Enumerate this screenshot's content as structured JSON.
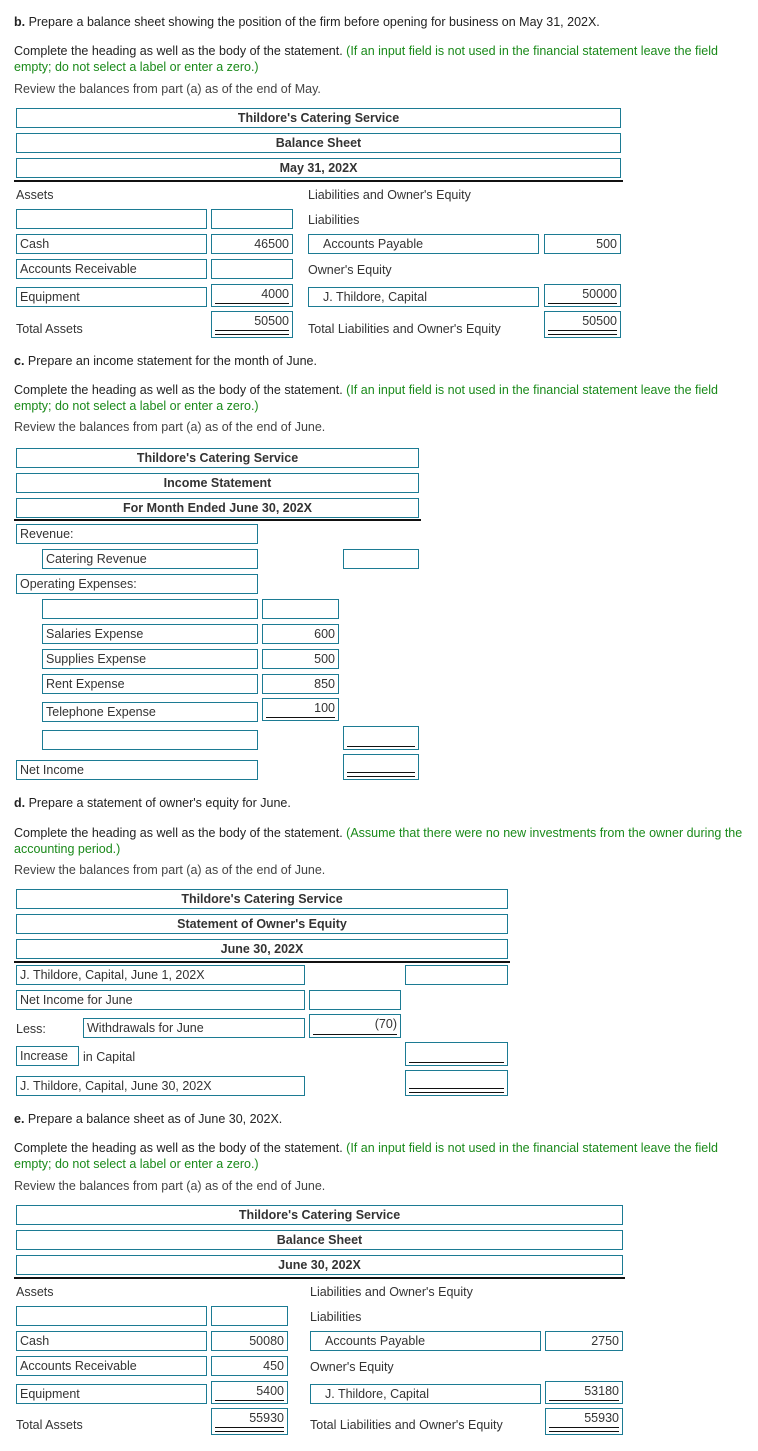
{
  "instructions": {
    "complete_heading": "Complete the heading as well as the body of the statement.",
    "note_blank": "(If an input field is not used in the financial statement leave the field empty; do not select a label or enter a zero.)",
    "note_no_investment": "(Assume that there were no new investments from the owner during the accounting period.)"
  },
  "part_b": {
    "letter": "b.",
    "prompt": "Prepare a balance sheet showing the position of the firm before opening for business on May 31, 202X.",
    "review": "Review the balances from part (a) as of the end of May.",
    "heading": {
      "company": "Thildore's Catering Service",
      "title": "Balance Sheet",
      "date": "May 31, 202X"
    },
    "assets_label": "Assets",
    "liab_equity_label": "Liabilities and Owner's Equity",
    "liabilities_label": "Liabilities",
    "owners_equity_label": "Owner's Equity",
    "total_assets_label": "Total Assets",
    "total_liab_equity_label": "Total Liabilities and Owner's Equity",
    "asset_rows": [
      {
        "label": "",
        "value": ""
      },
      {
        "label": "Cash",
        "value": "46500"
      },
      {
        "label": "Accounts Receivable",
        "value": ""
      },
      {
        "label": "Equipment",
        "value": "4000"
      }
    ],
    "total_assets": "50500",
    "liability_row": {
      "label": "Accounts Payable",
      "value": "500"
    },
    "equity_row": {
      "label": "J. Thildore, Capital",
      "value": "50000"
    },
    "total_liab_equity": "50500"
  },
  "part_c": {
    "letter": "c.",
    "prompt": "Prepare an income statement for the month of June.",
    "review": "Review the balances from part (a) as of the end of June.",
    "heading": {
      "company": "Thildore's Catering Service",
      "title": "Income Statement",
      "date": "For Month Ended June 30, 202X"
    },
    "revenue_label": "Revenue:",
    "revenue_row": {
      "label": "Catering Revenue",
      "value": ""
    },
    "opex_label": "Operating Expenses:",
    "expense_rows": [
      {
        "label": "",
        "value": ""
      },
      {
        "label": "Salaries Expense",
        "value": "600"
      },
      {
        "label": "Supplies Expense",
        "value": "500"
      },
      {
        "label": "Rent Expense",
        "value": "850"
      },
      {
        "label": "Telephone Expense",
        "value": "100"
      }
    ],
    "total_expense_row": {
      "label": "",
      "value": ""
    },
    "net_income_row": {
      "label": "Net Income",
      "value": ""
    }
  },
  "part_d": {
    "letter": "d.",
    "prompt": "Prepare a statement of owner's equity for June.",
    "review": "Review the balances from part (a) as of the end of June.",
    "heading": {
      "company": "Thildore's Catering Service",
      "title": "Statement of Owner's Equity",
      "date": "June 30, 202X"
    },
    "capital_begin": {
      "label": "J. Thildore, Capital, June 1, 202X",
      "value": ""
    },
    "net_income": {
      "label": "Net Income for June",
      "value": ""
    },
    "less_label": "Less:",
    "withdrawals": {
      "label": "Withdrawals for June",
      "value": "(70)"
    },
    "change_select": "Increase",
    "change_suffix": "in Capital",
    "change_value": "",
    "capital_end": {
      "label": "J. Thildore, Capital, June 30, 202X",
      "value": ""
    }
  },
  "part_e": {
    "letter": "e.",
    "prompt": "Prepare a balance sheet as of June 30, 202X.",
    "review": "Review the balances from part (a) as of the end of June.",
    "heading": {
      "company": "Thildore's Catering Service",
      "title": "Balance Sheet",
      "date": "June 30, 202X"
    },
    "assets_label": "Assets",
    "liab_equity_label": "Liabilities and Owner's Equity",
    "liabilities_label": "Liabilities",
    "owners_equity_label": "Owner's Equity",
    "total_assets_label": "Total Assets",
    "total_liab_equity_label": "Total Liabilities and Owner's Equity",
    "asset_rows": [
      {
        "label": "",
        "value": ""
      },
      {
        "label": "Cash",
        "value": "50080"
      },
      {
        "label": "Accounts Receivable",
        "value": "450"
      },
      {
        "label": "Equipment",
        "value": "5400"
      }
    ],
    "total_assets": "55930",
    "liability_row": {
      "label": "Accounts Payable",
      "value": "2750"
    },
    "equity_row": {
      "label": "J. Thildore, Capital",
      "value": "53180"
    },
    "total_liab_equity": "55930"
  }
}
